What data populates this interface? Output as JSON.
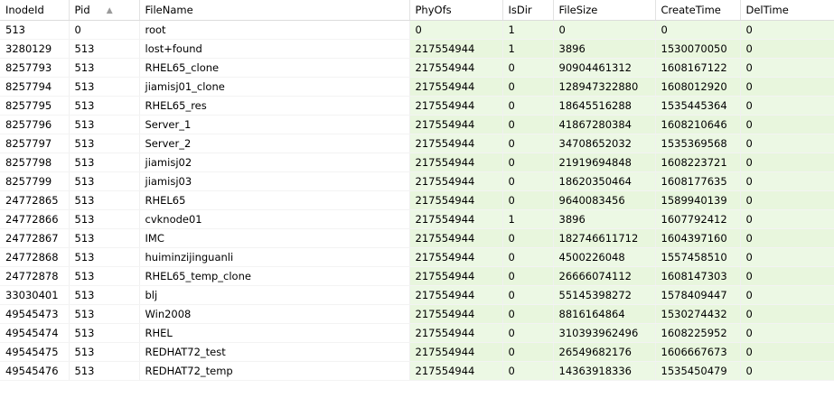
{
  "columns": [
    "InodeId",
    "Pid",
    "FileName",
    "PhyOfs",
    "IsDir",
    "FileSize",
    "CreateTime",
    "DelTime"
  ],
  "sort": {
    "column": "Pid",
    "direction": "ascending",
    "arrow": "▲"
  },
  "colors": {
    "band": "#ecf8e4",
    "header_border": "#dcdcdc"
  },
  "rows": [
    [
      "513",
      "0",
      "root",
      "0",
      "1",
      "0",
      "0",
      "0"
    ],
    [
      "3280129",
      "513",
      "lost+found",
      "217554944",
      "1",
      "3896",
      "1530070050",
      "0"
    ],
    [
      "8257793",
      "513",
      "RHEL65_clone",
      "217554944",
      "0",
      "90904461312",
      "1608167122",
      "0"
    ],
    [
      "8257794",
      "513",
      "jiamisj01_clone",
      "217554944",
      "0",
      "128947322880",
      "1608012920",
      "0"
    ],
    [
      "8257795",
      "513",
      "RHEL65_res",
      "217554944",
      "0",
      "18645516288",
      "1535445364",
      "0"
    ],
    [
      "8257796",
      "513",
      "Server_1",
      "217554944",
      "0",
      "41867280384",
      "1608210646",
      "0"
    ],
    [
      "8257797",
      "513",
      "Server_2",
      "217554944",
      "0",
      "34708652032",
      "1535369568",
      "0"
    ],
    [
      "8257798",
      "513",
      "jiamisj02",
      "217554944",
      "0",
      "21919694848",
      "1608223721",
      "0"
    ],
    [
      "8257799",
      "513",
      "jiamisj03",
      "217554944",
      "0",
      "18620350464",
      "1608177635",
      "0"
    ],
    [
      "24772865",
      "513",
      "RHEL65",
      "217554944",
      "0",
      "9640083456",
      "1589940139",
      "0"
    ],
    [
      "24772866",
      "513",
      "cvknode01",
      "217554944",
      "1",
      "3896",
      "1607792412",
      "0"
    ],
    [
      "24772867",
      "513",
      "IMC",
      "217554944",
      "0",
      "182746611712",
      "1604397160",
      "0"
    ],
    [
      "24772868",
      "513",
      "huiminzijinguanli",
      "217554944",
      "0",
      "4500226048",
      "1557458510",
      "0"
    ],
    [
      "24772878",
      "513",
      "RHEL65_temp_clone",
      "217554944",
      "0",
      "26666074112",
      "1608147303",
      "0"
    ],
    [
      "33030401",
      "513",
      "blj",
      "217554944",
      "0",
      "55145398272",
      "1578409447",
      "0"
    ],
    [
      "49545473",
      "513",
      "Win2008",
      "217554944",
      "0",
      "8816164864",
      "1530274432",
      "0"
    ],
    [
      "49545474",
      "513",
      "RHEL",
      "217554944",
      "0",
      "310393962496",
      "1608225952",
      "0"
    ],
    [
      "49545475",
      "513",
      "REDHAT72_test",
      "217554944",
      "0",
      "26549682176",
      "1606667673",
      "0"
    ],
    [
      "49545476",
      "513",
      "REDHAT72_temp",
      "217554944",
      "0",
      "14363918336",
      "1535450479",
      "0"
    ]
  ]
}
